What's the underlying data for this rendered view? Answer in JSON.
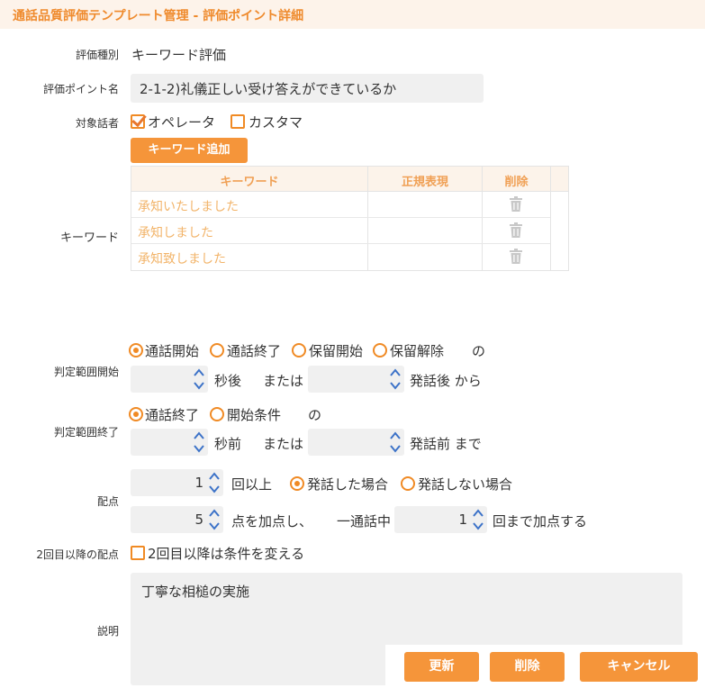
{
  "header": {
    "title": "通話品質評価テンプレート管理 - 評価ポイント詳細"
  },
  "eval_type": {
    "label": "評価種別",
    "value": "キーワード評価"
  },
  "eval_point": {
    "label": "評価ポイント名",
    "value": "2-1-2)礼儀正しい受け答えができているか"
  },
  "target_speaker": {
    "label": "対象話者",
    "options": [
      {
        "label": "オペレータ",
        "checked": true
      },
      {
        "label": "カスタマ",
        "checked": false
      }
    ]
  },
  "keywords": {
    "label": "キーワード",
    "add_button": "キーワード追加",
    "columns": [
      "キーワード",
      "正規表現",
      "削除"
    ],
    "rows": [
      {
        "keyword": "承知いたしました",
        "regex": "",
        "delete_icon": "trash-icon"
      },
      {
        "keyword": "承知しました",
        "regex": "",
        "delete_icon": "trash-icon"
      },
      {
        "keyword": "承知致しました",
        "regex": "",
        "delete_icon": "trash-icon"
      }
    ]
  },
  "range_start": {
    "label": "判定範囲開始",
    "options": [
      {
        "label": "通話開始",
        "selected": true
      },
      {
        "label": "通話終了",
        "selected": false
      },
      {
        "label": "保留開始",
        "selected": false
      },
      {
        "label": "保留解除",
        "selected": false
      }
    ],
    "suffix": "の",
    "seconds_value": "",
    "seconds_unit": "秒後",
    "or_text": "または",
    "utterance_value": "",
    "utterance_unit": "発話後 から"
  },
  "range_end": {
    "label": "判定範囲終了",
    "options": [
      {
        "label": "通話終了",
        "selected": true
      },
      {
        "label": "開始条件",
        "selected": false
      }
    ],
    "suffix": "の",
    "seconds_value": "",
    "seconds_unit": "秒前",
    "or_text": "または",
    "utterance_value": "",
    "utterance_unit": "発話前 まで"
  },
  "score": {
    "label": "配点",
    "count_value": "1",
    "count_unit": "回以上",
    "options": [
      {
        "label": "発話した場合",
        "selected": true
      },
      {
        "label": "発話しない場合",
        "selected": false
      }
    ],
    "points_value": "5",
    "points_text": "点を加点し、",
    "per_call_text": "一通話中",
    "max_value": "1",
    "max_text": "回まで加点する"
  },
  "second_score": {
    "label": "2回目以降の配点",
    "option_label": "2回目以降は条件を変える",
    "checked": false
  },
  "description": {
    "label": "説明",
    "value": "丁寧な相槌の実施"
  },
  "footer": {
    "update_label": "更新",
    "delete_label": "削除",
    "cancel_label": "キャンセル"
  },
  "colors": {
    "accent": "#f5953a",
    "header_bg": "#fdf3ea",
    "field_bg": "#f0f0f0",
    "keyword_text": "#f2b46a"
  }
}
